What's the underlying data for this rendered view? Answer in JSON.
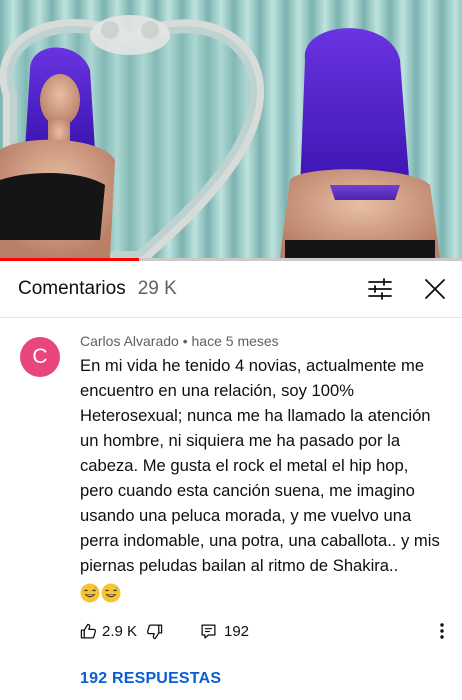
{
  "video": {
    "progress_fraction": 0.3,
    "accent_color": "#ff0000"
  },
  "header": {
    "title": "Comentarios",
    "count": "29 K",
    "filter_icon": "sort-filter-icon",
    "close_icon": "close-icon"
  },
  "comment": {
    "avatar_letter": "C",
    "avatar_color": "#e8467d",
    "author": "Carlos Alvarado",
    "separator": " • ",
    "time": "hace 5 meses",
    "text": "En mi vida he tenido 4 novias, actualmente me encuentro en una relación, soy 100% Heterosexual; nunca me ha llamado la atención un hombre, ni siquiera me ha pasado por la cabeza. Me gusta el rock el metal el hip hop, pero cuando esta canción suena, me imagino usando una peluca morada, y me vuelvo una perra indomable, una potra, una caballota.. y mis piernas peludas bailan al ritmo de Shakira..",
    "emojis": [
      "grinning-sweat-emoji",
      "grinning-sweat-emoji"
    ],
    "likes": "2.9 K",
    "replies_count": "192",
    "icons": {
      "like": "thumbs-up-icon",
      "dislike": "thumbs-down-icon",
      "reply": "reply-icon",
      "more": "more-vertical-icon"
    }
  },
  "replies_link": "192 RESPUESTAS",
  "colors": {
    "link": "#065fd4",
    "secondary_text": "#606060"
  }
}
